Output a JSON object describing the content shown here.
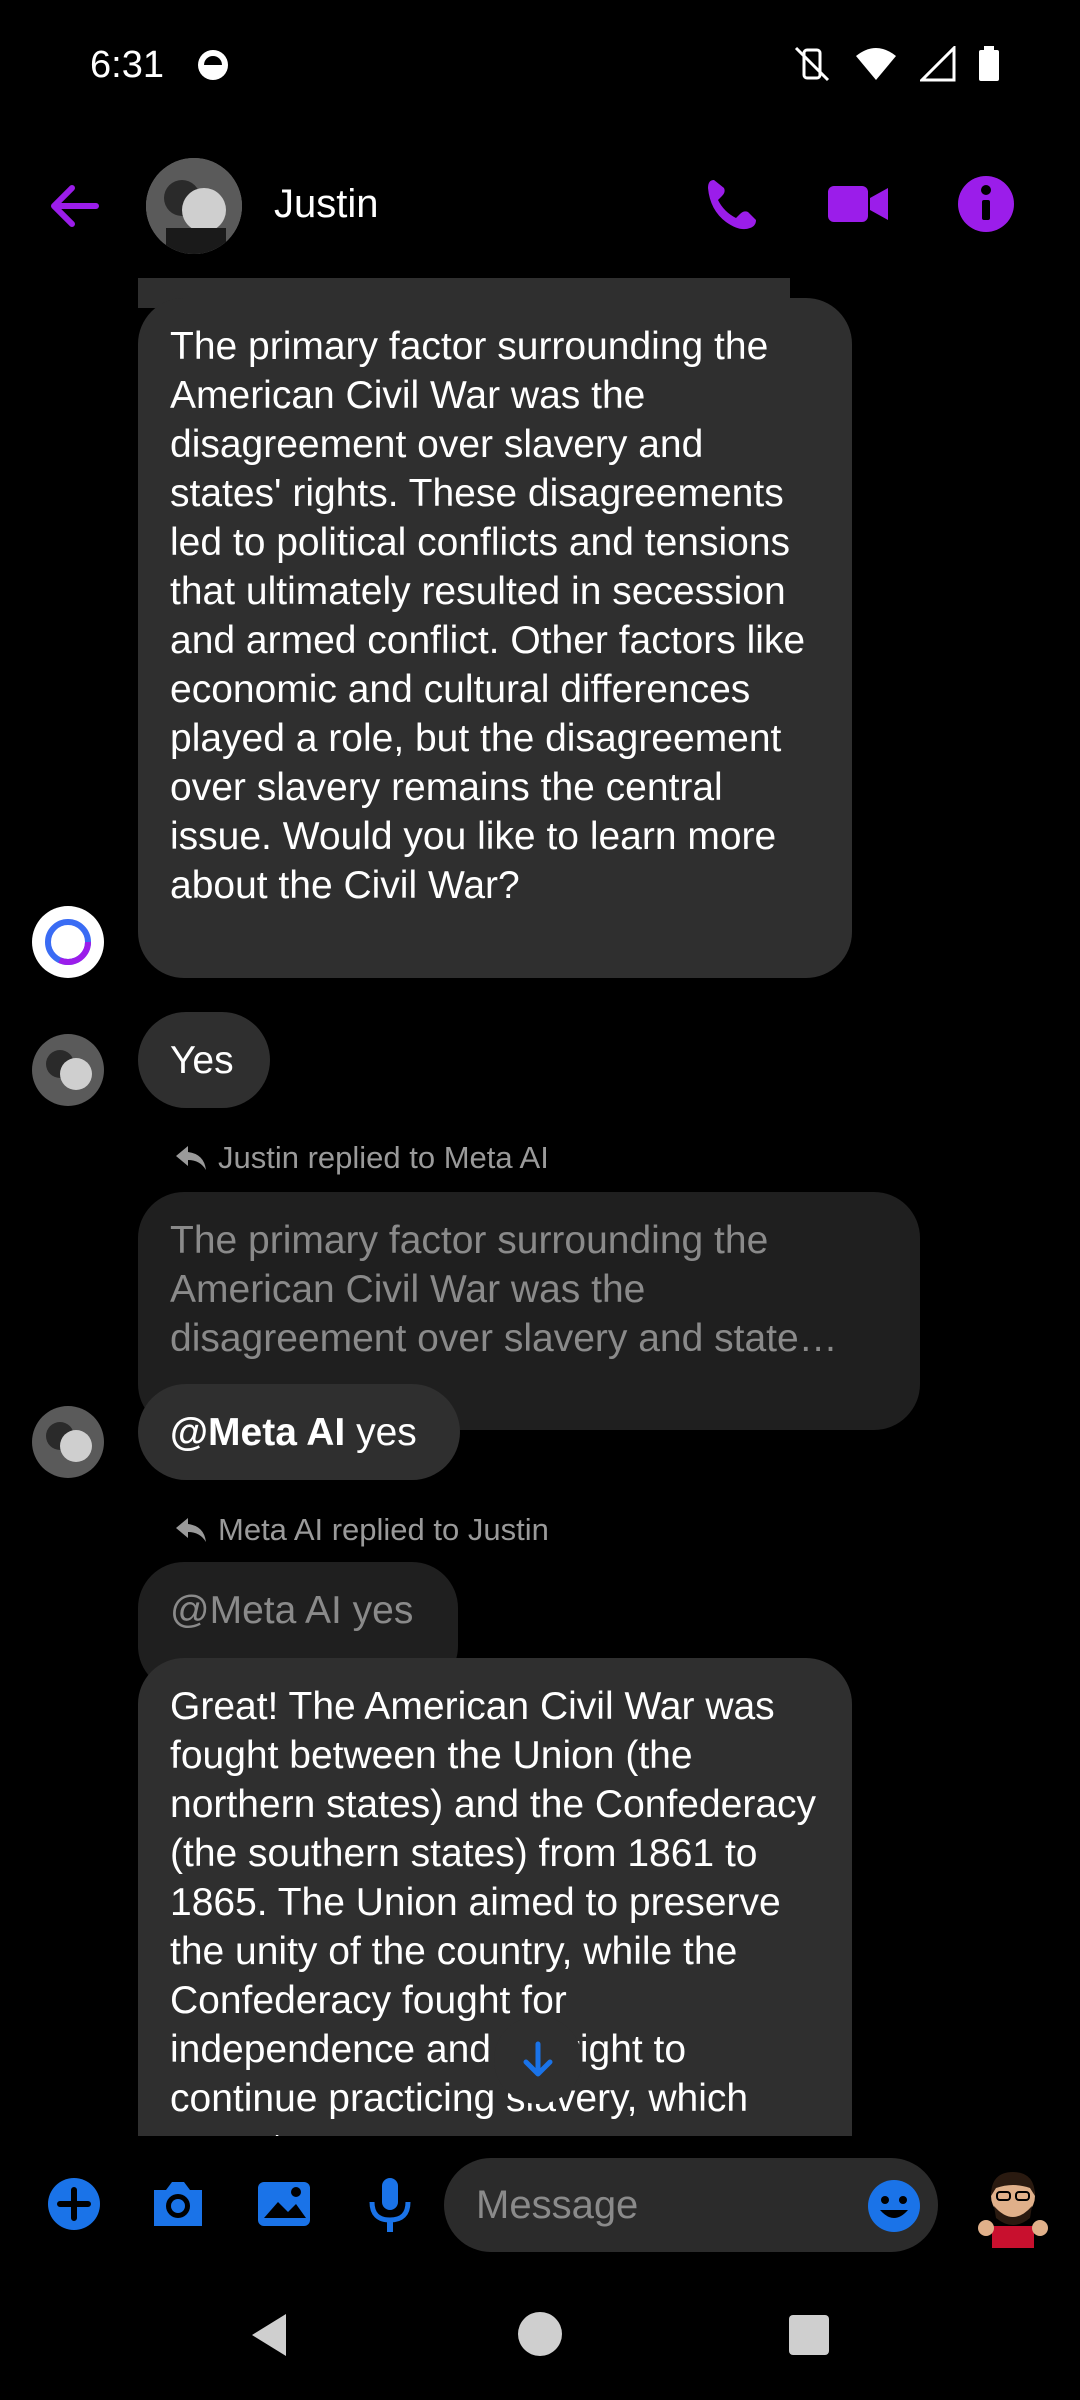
{
  "status": {
    "time": "6:31"
  },
  "header": {
    "contact_name": "Justin"
  },
  "messages": {
    "m1": "The primary factor surrounding the American Civil War was the disagreement over slavery and states' rights. These disagreements led to political conflicts and tensions that ultimately resulted in secession and armed conflict. Other factors like economic and cultural differences played a role, but the disagreement over slavery remains the central issue. Would you like to learn more about the Civil War?",
    "m2": "Yes",
    "reply1_note": "Justin replied to Meta AI",
    "reply1_quote": "The primary factor surrounding the American Civil War was the disagreement over slavery and state…",
    "m3_mention": "@Meta AI",
    "m3_text": " yes",
    "reply2_note": "Meta AI replied to Justin",
    "reply2_quote": "@Meta AI yes",
    "m4": "Great! The American Civil War was fought between the Union (the northern states) and the Confederacy (the southern states) from 1861 to 1865. The Union aimed to preserve the unity of the country, while the Confederacy fought for independence and the right to continue practicing slavery, which was at..."
  },
  "composer": {
    "placeholder": "Message"
  },
  "colors": {
    "accent_purple": "#9b1dea",
    "accent_blue": "#1a73e8",
    "bubble": "#2f2f2f"
  }
}
